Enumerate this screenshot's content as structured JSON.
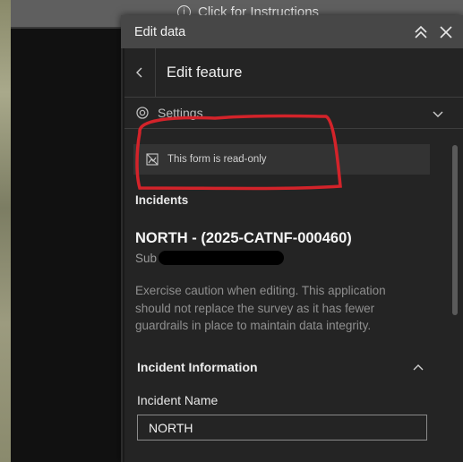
{
  "banner": {
    "hint": "Click for Instructions"
  },
  "panel": {
    "title": "Edit data",
    "edit_title": "Edit feature",
    "settings_label": "Settings",
    "notice": "This form is read-only",
    "layer_name": "Incidents",
    "feature_title": "NORTH - (2025-CATNF-000460)",
    "subtitle_prefix": "Sub",
    "caution": "Exercise caution when editing. This application should not replace the survey as it has fewer guardrails in place to maintain data integrity.",
    "group_title": "Incident Information",
    "field_label": "Incident Name",
    "field_value": "NORTH"
  },
  "annotation_color": "#d3232a"
}
